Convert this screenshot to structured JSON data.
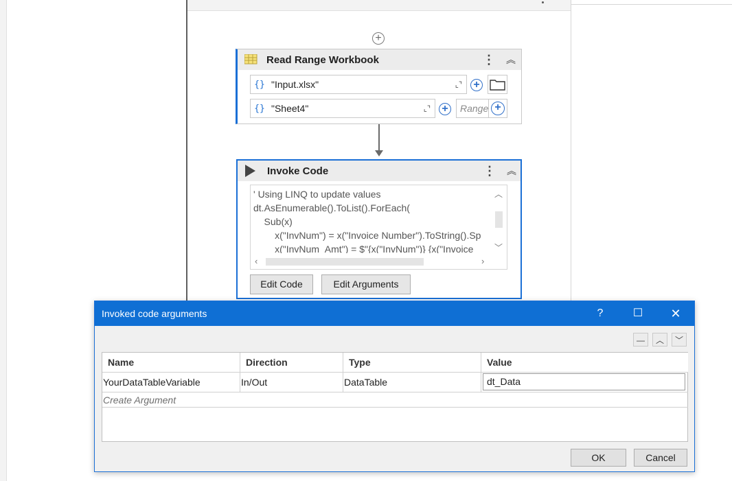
{
  "read_range": {
    "title": "Read Range Workbook",
    "workbook_path": "\"Input.xlsx\"",
    "sheet_name": "\"Sheet4\"",
    "range_placeholder": "Range"
  },
  "invoke_code": {
    "title": "Invoke Code",
    "code_lines": [
      "' Using LINQ to update values",
      "dt.AsEnumerable().ToList().ForEach(",
      "    Sub(x)",
      "        x(\"InvNum\") = x(\"Invoice Number\").ToString().Sp",
      "        x(\"InvNum_Amt\") = $\"{x(\"InvNum\")} {x(\"Invoice"
    ],
    "edit_code_label": "Edit Code",
    "edit_arguments_label": "Edit Arguments"
  },
  "dialog": {
    "title": "Invoked code arguments",
    "help": "?",
    "columns": [
      "Name",
      "Direction",
      "Type",
      "Value"
    ],
    "rows": [
      {
        "name": "YourDataTableVariable",
        "direction": "In/Out",
        "type": "DataTable",
        "value": "dt_Data"
      }
    ],
    "create_argument": "Create Argument",
    "ok_label": "OK",
    "cancel_label": "Cancel"
  },
  "colors": {
    "accent": "#0f6fd4",
    "selection": "#1a6fd6"
  },
  "icons": [
    "add-icon",
    "excel-table-icon",
    "kebab-menu-icon",
    "collapse-icon",
    "curly-braces-icon",
    "expand-icon",
    "folder-icon",
    "play-icon",
    "help-icon",
    "maximize-icon",
    "close-icon",
    "remove-icon",
    "move-up-icon",
    "move-down-icon"
  ]
}
